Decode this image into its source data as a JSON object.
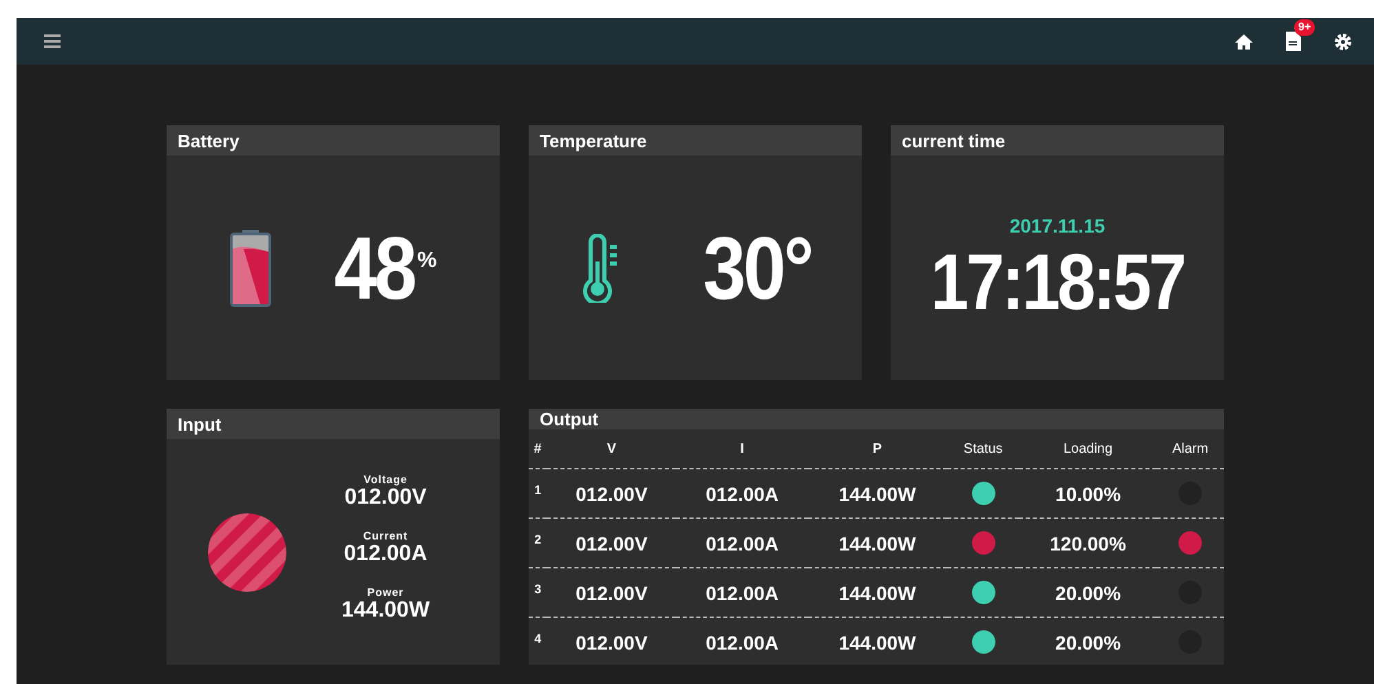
{
  "topbar": {
    "notification_badge": "9+"
  },
  "battery": {
    "title": "Battery",
    "value": "48",
    "unit": "%"
  },
  "temperature": {
    "title": "Temperature",
    "value": "30°"
  },
  "current_time": {
    "title": "current time",
    "date": "2017.11.15",
    "time": "17:18:57"
  },
  "input": {
    "title": "Input",
    "readings": [
      {
        "label": "Voltage",
        "value": "012.00V"
      },
      {
        "label": "Current",
        "value": "012.00A"
      },
      {
        "label": "Power",
        "value": "144.00W"
      }
    ]
  },
  "output": {
    "title": "Output",
    "columns": [
      "#",
      "V",
      "I",
      "P",
      "Status",
      "Loading",
      "Alarm"
    ],
    "rows": [
      {
        "index": "1",
        "v": "012.00V",
        "i": "012.00A",
        "p": "144.00W",
        "status": {
          "color": "#3ecfb0"
        },
        "loading": "10.00%",
        "alarm": {
          "color": "#222222"
        }
      },
      {
        "index": "2",
        "v": "012.00V",
        "i": "012.00A",
        "p": "144.00W",
        "status": {
          "color": "#d01a48"
        },
        "loading": "120.00%",
        "alarm": {
          "color": "#d01a48"
        }
      },
      {
        "index": "3",
        "v": "012.00V",
        "i": "012.00A",
        "p": "144.00W",
        "status": {
          "color": "#3ecfb0"
        },
        "loading": "20.00%",
        "alarm": {
          "color": "#222222"
        }
      },
      {
        "index": "4",
        "v": "012.00V",
        "i": "012.00A",
        "p": "144.00W",
        "status": {
          "color": "#3ecfb0"
        },
        "loading": "20.00%",
        "alarm": {
          "color": "#222222"
        }
      }
    ]
  }
}
